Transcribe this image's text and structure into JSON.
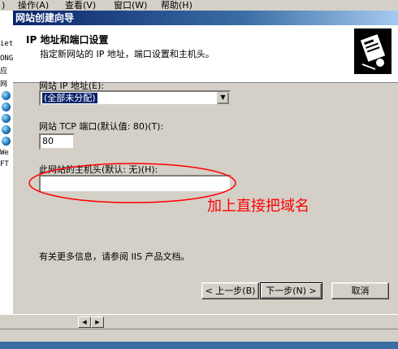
{
  "menu": {
    "item0": ")",
    "action": "操作(A)",
    "view": "查看(V)",
    "window": "窗口(W)",
    "help": "帮助(H)"
  },
  "background_tree": {
    "fragments": [
      "iet",
      "ONG",
      "应",
      "网",
      "We",
      "FT"
    ]
  },
  "dialog": {
    "title": "网站创建向导",
    "header_title": "IP 地址和端口设置",
    "header_subtitle": "指定新网站的 IP 地址，端口设置和主机头。",
    "ip_label": "网站 IP 地址(E):",
    "ip_value": "(全部未分配)",
    "tcp_label": "网站 TCP 端口(默认值: 80)(T):",
    "tcp_value": "80",
    "host_label": "此网站的主机头(默认: 无)(H):",
    "host_value": "",
    "footnote": "有关更多信息，请参阅 IIS 产品文档。",
    "buttons": {
      "back": "< 上一步(B)",
      "next": "下一步(N) >",
      "cancel": "取消"
    }
  },
  "annotation": {
    "text": "加上直接把域名",
    "color": "#ff0000"
  },
  "colors": {
    "titlebar_start": "#0a246a",
    "titlebar_end": "#a6caf0",
    "face": "#d4d0c8"
  }
}
